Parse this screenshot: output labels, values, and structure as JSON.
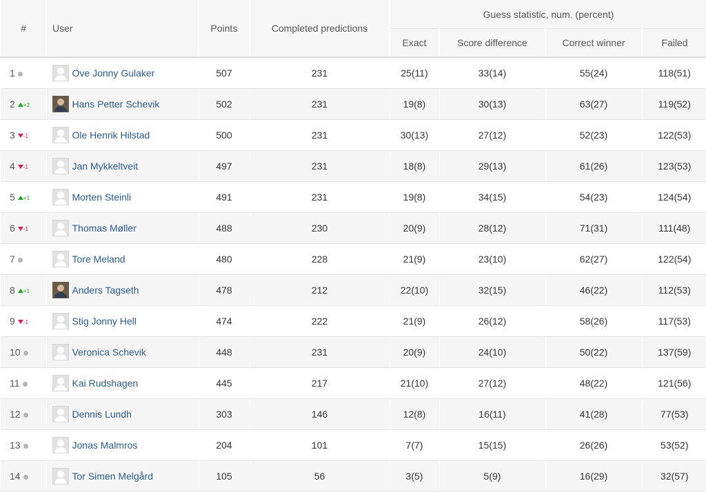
{
  "headers": {
    "rank": "#",
    "user": "User",
    "points": "Points",
    "completed": "Completed predictions",
    "guess_group": "Guess statistic, num. (percent)",
    "exact": "Exact",
    "score_diff": "Score difference",
    "correct_winner": "Correct winner",
    "failed": "Failed"
  },
  "colors": {
    "link": "#2a5a8f",
    "up": "#1fa51f",
    "down": "#d0205a",
    "neutral": "#b4b4b4"
  },
  "rows": [
    {
      "rank": "1",
      "trend": "same",
      "change": "",
      "avatar": "default-avatar",
      "name": "Ove Jonny Gulaker",
      "points": "507",
      "completed": "231",
      "exact": "25(11)",
      "score_diff": "33(14)",
      "correct_winner": "55(24)",
      "failed": "118(51)"
    },
    {
      "rank": "2",
      "trend": "up",
      "change": "+2",
      "avatar": "photo-avatar",
      "name": "Hans Petter Schevik",
      "points": "502",
      "completed": "231",
      "exact": "19(8)",
      "score_diff": "30(13)",
      "correct_winner": "63(27)",
      "failed": "119(52)"
    },
    {
      "rank": "3",
      "trend": "down",
      "change": "-1",
      "avatar": "default-avatar",
      "name": "Ole Henrik Hilstad",
      "points": "500",
      "completed": "231",
      "exact": "30(13)",
      "score_diff": "27(12)",
      "correct_winner": "52(23)",
      "failed": "122(53)"
    },
    {
      "rank": "4",
      "trend": "down",
      "change": "-1",
      "avatar": "default-avatar",
      "name": "Jan Mykkeltveit",
      "points": "497",
      "completed": "231",
      "exact": "18(8)",
      "score_diff": "29(13)",
      "correct_winner": "61(26)",
      "failed": "123(53)"
    },
    {
      "rank": "5",
      "trend": "up",
      "change": "+1",
      "avatar": "default-avatar",
      "name": "Morten Steinli",
      "points": "491",
      "completed": "231",
      "exact": "19(8)",
      "score_diff": "34(15)",
      "correct_winner": "54(23)",
      "failed": "124(54)"
    },
    {
      "rank": "6",
      "trend": "down",
      "change": "-1",
      "avatar": "default-avatar",
      "name": "Thomas Møller",
      "points": "488",
      "completed": "230",
      "exact": "20(9)",
      "score_diff": "28(12)",
      "correct_winner": "71(31)",
      "failed": "111(48)"
    },
    {
      "rank": "7",
      "trend": "same",
      "change": "",
      "avatar": "default-avatar",
      "name": "Tore Meland",
      "points": "480",
      "completed": "228",
      "exact": "21(9)",
      "score_diff": "23(10)",
      "correct_winner": "62(27)",
      "failed": "122(54)"
    },
    {
      "rank": "8",
      "trend": "up",
      "change": "+1",
      "avatar": "photo-avatar",
      "name": "Anders Tagseth",
      "points": "478",
      "completed": "212",
      "exact": "22(10)",
      "score_diff": "32(15)",
      "correct_winner": "46(22)",
      "failed": "112(53)"
    },
    {
      "rank": "9",
      "trend": "down",
      "change": "-1",
      "avatar": "default-avatar",
      "name": "Stig Jonny Hell",
      "points": "474",
      "completed": "222",
      "exact": "21(9)",
      "score_diff": "26(12)",
      "correct_winner": "58(26)",
      "failed": "117(53)"
    },
    {
      "rank": "10",
      "trend": "same",
      "change": "",
      "avatar": "default-avatar",
      "name": "Veronica Schevik",
      "points": "448",
      "completed": "231",
      "exact": "20(9)",
      "score_diff": "24(10)",
      "correct_winner": "50(22)",
      "failed": "137(59)"
    },
    {
      "rank": "11",
      "trend": "same",
      "change": "",
      "avatar": "default-avatar",
      "name": "Kai Rudshagen",
      "points": "445",
      "completed": "217",
      "exact": "21(10)",
      "score_diff": "27(12)",
      "correct_winner": "48(22)",
      "failed": "121(56)"
    },
    {
      "rank": "12",
      "trend": "same",
      "change": "",
      "avatar": "default-avatar",
      "name": "Dennis Lundh",
      "points": "303",
      "completed": "146",
      "exact": "12(8)",
      "score_diff": "16(11)",
      "correct_winner": "41(28)",
      "failed": "77(53)"
    },
    {
      "rank": "13",
      "trend": "same",
      "change": "",
      "avatar": "default-avatar",
      "name": "Jonas Malmros",
      "points": "204",
      "completed": "101",
      "exact": "7(7)",
      "score_diff": "15(15)",
      "correct_winner": "26(26)",
      "failed": "53(52)"
    },
    {
      "rank": "14",
      "trend": "same",
      "change": "",
      "avatar": "default-avatar",
      "name": "Tor Simen Melgård",
      "points": "105",
      "completed": "56",
      "exact": "3(5)",
      "score_diff": "5(9)",
      "correct_winner": "16(29)",
      "failed": "32(57)"
    }
  ]
}
